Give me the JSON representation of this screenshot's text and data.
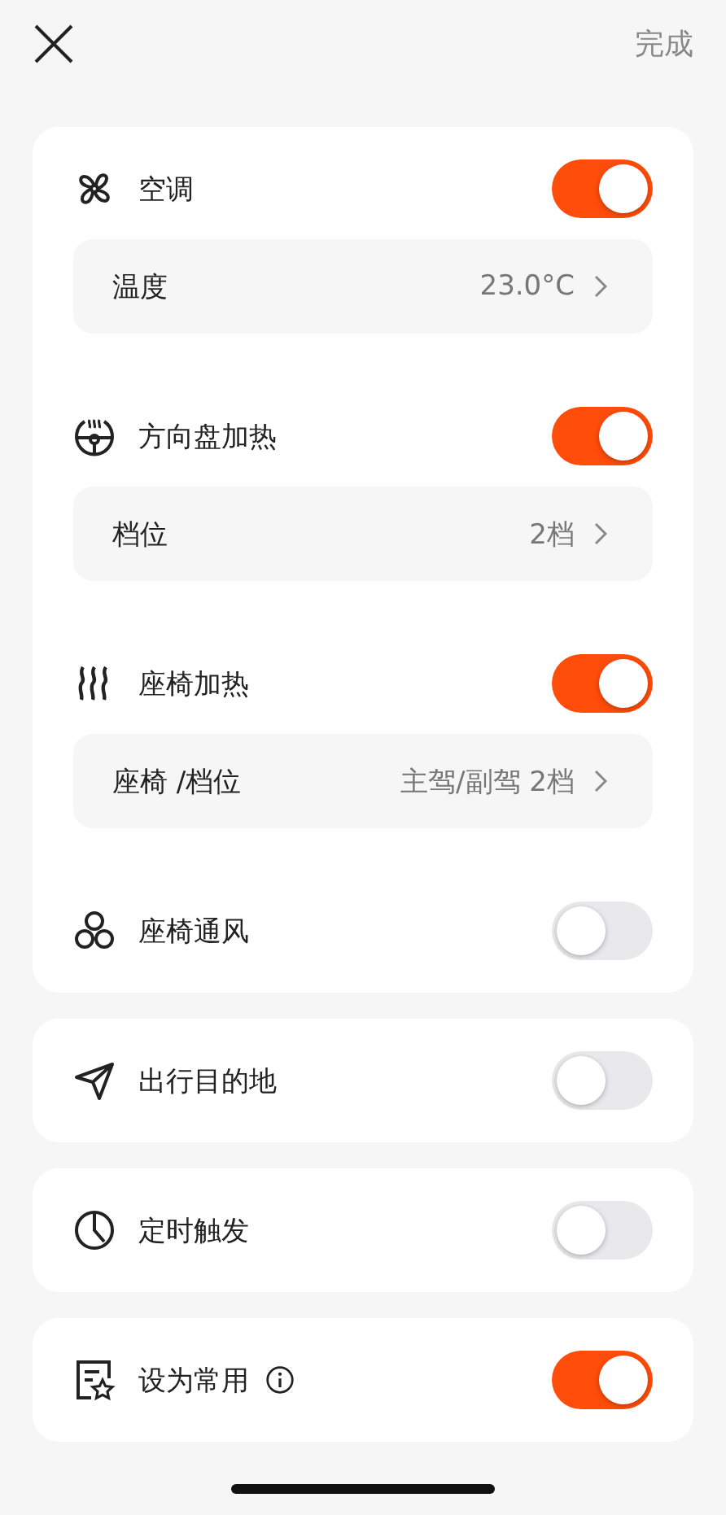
{
  "header": {
    "done": "完成"
  },
  "cards": [
    {
      "items": [
        {
          "label": "空调",
          "on": true,
          "detail": {
            "label": "温度",
            "value": "23.0°C"
          }
        },
        {
          "label": "方向盘加热",
          "on": true,
          "detail": {
            "label": "档位",
            "value": "2档"
          }
        },
        {
          "label": "座椅加热",
          "on": true,
          "detail": {
            "label": "座椅 /档位",
            "value": "主驾/副驾 2档"
          }
        },
        {
          "label": "座椅通风",
          "on": false
        }
      ]
    },
    {
      "items": [
        {
          "label": "出行目的地",
          "on": false
        }
      ]
    },
    {
      "items": [
        {
          "label": "定时触发",
          "on": false
        }
      ]
    },
    {
      "items": [
        {
          "label": "设为常用",
          "on": true,
          "info": true
        }
      ]
    }
  ]
}
